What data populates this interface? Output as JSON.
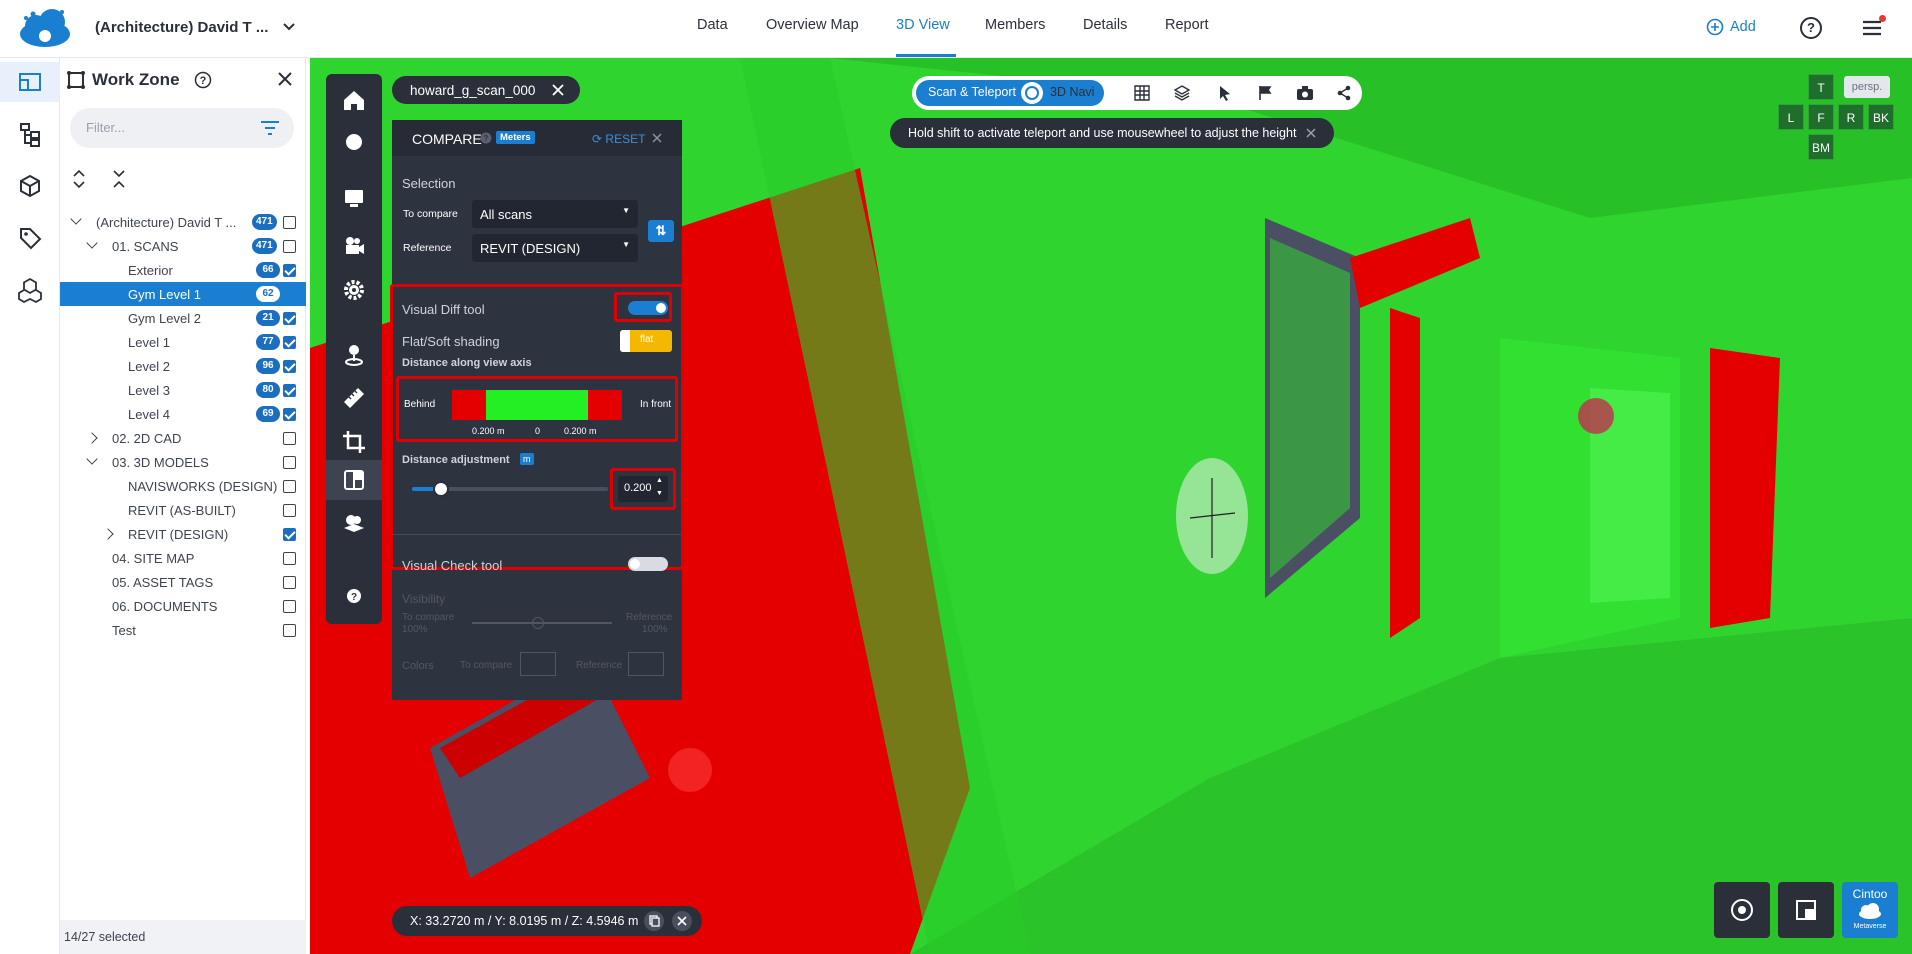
{
  "header": {
    "project_title": "(Architecture) David T ...",
    "tabs": [
      {
        "label": "Data",
        "active": false
      },
      {
        "label": "Overview Map",
        "active": false
      },
      {
        "label": "3D View",
        "active": true
      },
      {
        "label": "Members",
        "active": false
      },
      {
        "label": "Details",
        "active": false
      },
      {
        "label": "Report",
        "active": false
      }
    ],
    "add_label": "Add",
    "help_label": "?"
  },
  "colors": {
    "accent": "#1a7fd1",
    "panel_dark": "#2e3340",
    "diff_green": "#2fd42f",
    "diff_red": "#e50000",
    "highlight_red": "#e00000",
    "toggle_yellow": "#f5b800"
  },
  "rail_icons": [
    "workzone-icon",
    "hierarchy-icon",
    "cube-icon",
    "tag-icon",
    "models-icon"
  ],
  "workzone": {
    "title": "Work Zone",
    "filter_placeholder": "Filter...",
    "tree": [
      {
        "label": "(Architecture) David T ...",
        "badge": "471",
        "checked": false,
        "selected": false
      },
      {
        "label": "01. SCANS",
        "badge": "471",
        "checked": false,
        "selected": false
      },
      {
        "label": "Exterior",
        "badge": "66",
        "checked": true,
        "selected": false
      },
      {
        "label": "Gym Level 1",
        "badge": "62",
        "checked": true,
        "selected": true
      },
      {
        "label": "Gym Level 2",
        "badge": "21",
        "checked": true,
        "selected": false
      },
      {
        "label": "Level 1",
        "badge": "77",
        "checked": true,
        "selected": false
      },
      {
        "label": "Level 2",
        "badge": "96",
        "checked": true,
        "selected": false
      },
      {
        "label": "Level 3",
        "badge": "80",
        "checked": true,
        "selected": false
      },
      {
        "label": "Level 4",
        "badge": "69",
        "checked": true,
        "selected": false
      },
      {
        "label": "02. 2D CAD",
        "badge": "",
        "checked": false,
        "selected": false
      },
      {
        "label": "03. 3D MODELS",
        "badge": "",
        "checked": false,
        "selected": false
      },
      {
        "label": "NAVISWORKS (DESIGN)",
        "badge": "",
        "checked": false,
        "selected": false
      },
      {
        "label": "REVIT (AS-BUILT)",
        "badge": "",
        "checked": false,
        "selected": false
      },
      {
        "label": "REVIT (DESIGN)",
        "badge": "",
        "checked": true,
        "selected": false
      },
      {
        "label": "04. SITE MAP",
        "badge": "",
        "checked": false,
        "selected": false
      },
      {
        "label": "05. ASSET TAGS",
        "badge": "",
        "checked": false,
        "selected": false
      },
      {
        "label": "06. DOCUMENTS",
        "badge": "",
        "checked": false,
        "selected": false
      },
      {
        "label": "Test",
        "badge": "",
        "checked": false,
        "selected": false
      }
    ],
    "footer": "14/27 selected"
  },
  "viewer": {
    "scan_chip": "howard_g_scan_000",
    "nav_mode_active": "Scan & Teleport",
    "nav_mode_other": "3D Navi",
    "tip": "Hold shift to activate teleport and use mousewheel to adjust the height",
    "coordinates": "X: 33.2720 m / Y: 8.0195 m / Z: 4.5946 m",
    "view_cube": {
      "top": "T",
      "persp": "persp.",
      "left": "L",
      "front": "F",
      "right": "R",
      "back": "BK",
      "bottom": "BM"
    },
    "cintoo_label": "Cintoo",
    "metaverse_label": "Metaverse"
  },
  "compare": {
    "title": "COMPARE",
    "units_badge": "Meters",
    "reset": "RESET",
    "selection_label": "Selection",
    "to_compare_label": "To compare",
    "to_compare_value": "All scans",
    "reference_label": "Reference",
    "reference_value": "REVIT (DESIGN)",
    "visual_diff_label": "Visual Diff tool",
    "visual_diff_on": true,
    "shading_label": "Flat/Soft shading",
    "shading_value": "flat",
    "distance_axis_label": "Distance along view axis",
    "behind_label": "Behind",
    "front_label": "In front",
    "ticks": [
      "0.200 m",
      "0",
      "0.200 m"
    ],
    "distance_adj_label": "Distance adjustment",
    "distance_adj_badge": "m",
    "distance_value": "0.200",
    "slider_fraction": 0.15,
    "visual_check_label": "Visual Check tool",
    "visual_check_on": false,
    "visibility_label": "Visibility",
    "vis_to_compare": "To compare",
    "vis_to_compare_pct": "100%",
    "vis_reference": "Reference",
    "vis_reference_pct": "100%",
    "colors_label": "Colors",
    "colors_to_compare": "To compare",
    "colors_reference": "Reference"
  }
}
